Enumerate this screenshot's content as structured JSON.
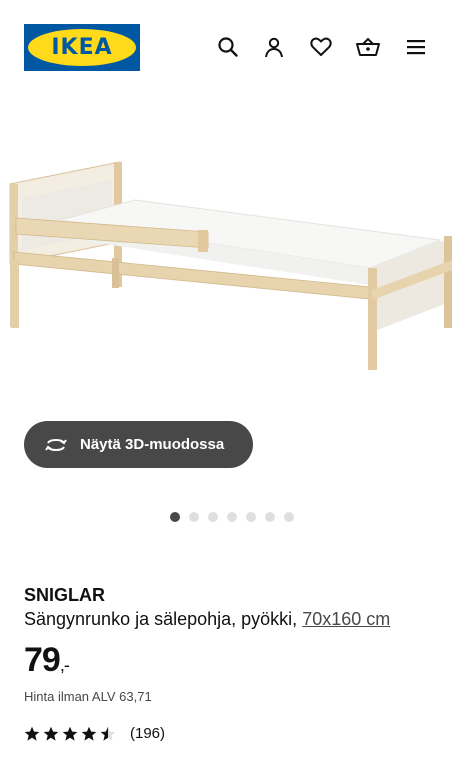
{
  "header": {
    "logo_text": "IKEA",
    "icons": [
      "search-icon",
      "profile-icon",
      "heart-icon",
      "basket-icon",
      "menu-icon"
    ]
  },
  "gallery": {
    "view_3d_label": "Näytä 3D-muodossa",
    "view_3d_icon": "rotate-3d-icon",
    "image_count": 7,
    "active_image": 1
  },
  "product": {
    "name": "SNIGLAR",
    "description": "Sängynrunko ja sälepohja, pyökki,",
    "dimensions": "70x160 cm",
    "price_main": "79",
    "price_suffix": ",-",
    "vat_text": "Hinta ilman ALV 63,71",
    "rating_value": 4.5,
    "rating_max": 5,
    "review_count": "(196)"
  },
  "colors": {
    "ikea_blue": "#0058a3",
    "ikea_yellow": "#ffda1a",
    "pill_bg": "#484848"
  }
}
